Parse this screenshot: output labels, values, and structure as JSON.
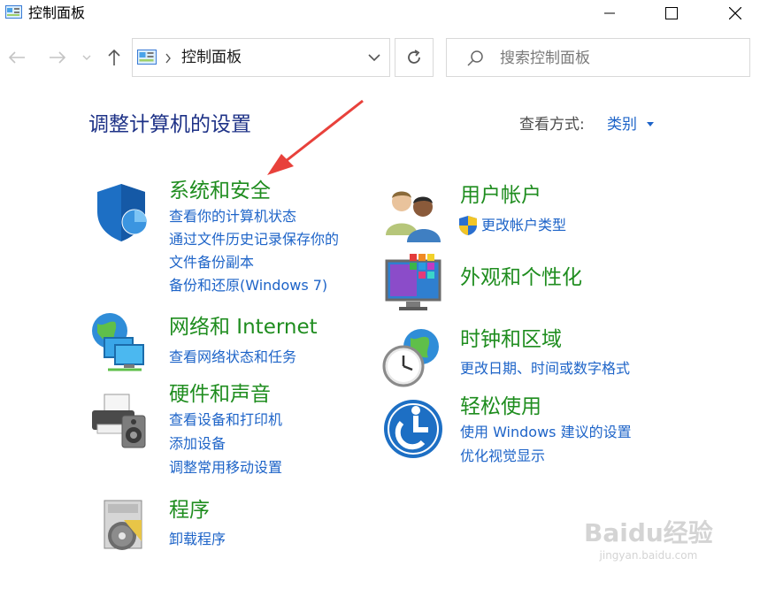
{
  "window": {
    "title": "控制面板"
  },
  "address_bar": {
    "path": "控制面板"
  },
  "search": {
    "placeholder": "搜索控制面板"
  },
  "header": {
    "title": "调整计算机的设置",
    "view_by_label": "查看方式:",
    "view_by_value": "类别"
  },
  "categories": [
    {
      "title": "系统和安全",
      "icon": "shield-icon",
      "links": [
        "查看你的计算机状态",
        "通过文件历史记录保存你的",
        "文件备份副本",
        "备份和还原(Windows 7)"
      ]
    },
    {
      "title": "网络和 Internet",
      "icon": "network-globe-icon",
      "links": [
        "查看网络状态和任务"
      ]
    },
    {
      "title": "硬件和声音",
      "icon": "printer-speaker-icon",
      "links": [
        "查看设备和打印机",
        "添加设备",
        "调整常用移动设置"
      ]
    },
    {
      "title": "程序",
      "icon": "programs-disc-icon",
      "links": [
        "卸载程序"
      ]
    },
    {
      "title": "用户帐户",
      "icon": "users-icon",
      "links": [
        "更改帐户类型"
      ]
    },
    {
      "title": "外观和个性化",
      "icon": "monitor-colors-icon",
      "links": []
    },
    {
      "title": "时钟和区域",
      "icon": "clock-globe-icon",
      "links": [
        "更改日期、时间或数字格式"
      ]
    },
    {
      "title": "轻松使用",
      "icon": "accessibility-icon",
      "links": [
        "使用 Windows 建议的设置",
        "优化视觉显示"
      ]
    }
  ],
  "watermark": {
    "text": "Baidu经验",
    "sub": "jingyan.baidu.com"
  },
  "colors": {
    "category_title": "#1f8d1f",
    "link": "#1e64c8",
    "page_title": "#1e3287",
    "annotation_arrow": "#e8413b"
  }
}
